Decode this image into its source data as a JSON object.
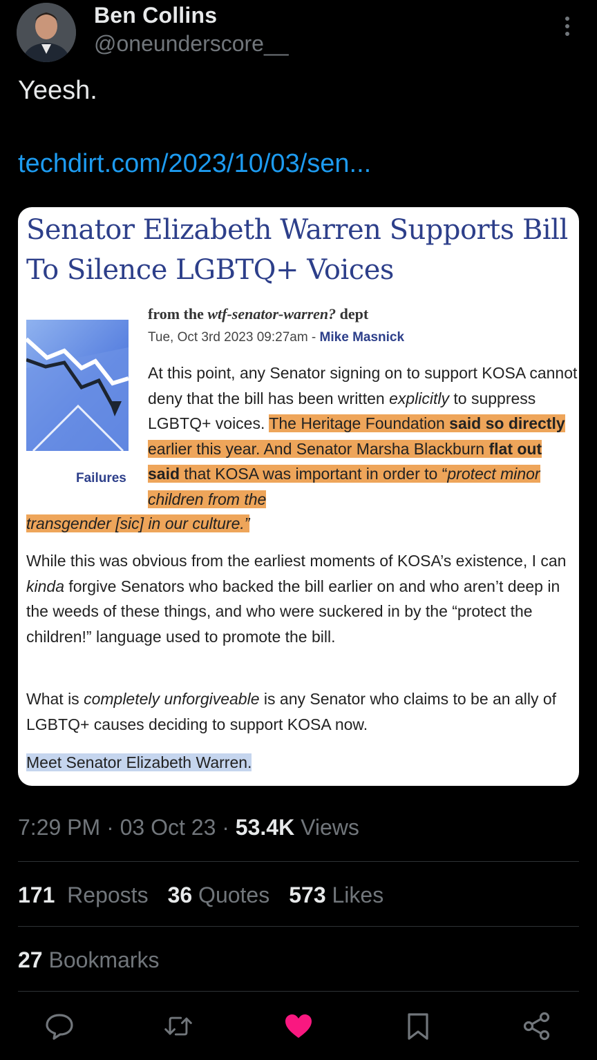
{
  "author": {
    "name": "Ben Collins",
    "handle": "@oneunderscore__"
  },
  "icons": {
    "more": "more-vertical-icon",
    "reply": "reply-icon",
    "repost": "repost-icon",
    "like": "heart-icon",
    "bookmark": "bookmark-icon",
    "share": "share-icon"
  },
  "colors": {
    "background": "#000000",
    "link": "#1d9bf0",
    "like_active": "#f91880",
    "highlight": "#eea55a",
    "headline": "#2d3f8a"
  },
  "tweet": {
    "text": "Yeesh.",
    "link": "techdirt.com/2023/10/03/sen..."
  },
  "card": {
    "headline": "Senator Elizabeth Warren Supports Bill To Silence LGBTQ+ Voices",
    "dept_prefix": "from the ",
    "dept_name": "wtf-senator-warren?",
    "dept_suffix": " dept",
    "date": "Tue, Oct 3rd 2023 09:27am - ",
    "byline_author": "Mike Masnick",
    "thumbnail_caption": "Failures",
    "p1_a": "At this point, any Senator signing on to support KOSA cannot deny that the bill has been written ",
    "p1_em": "explicitly",
    "p1_b": " to suppress LGBTQ+ voices. ",
    "p1_hl_1": "The Heritage Foundation ",
    "p1_hl_2": "said so directly",
    "p1_hl_3": " earlier this year. And Senator Marsha Blackburn ",
    "p1_hl_4": "flat out said",
    "p1_hl_5": " that KOSA was important in order to “",
    "p1_hl_6": "protect minor children from the",
    "p1_tail": "transgender [sic] in our culture.”",
    "p2_a": "While this was obvious from the earliest moments of KOSA’s existence, I can ",
    "p2_em": "kinda",
    "p2_b": " forgive Senators who backed the bill earlier on and who aren’t deep in the weeds of these things, and who were suckered in by the “protect the children!” language used to promote the bill.",
    "p3_a": "What is ",
    "p3_em": "completely unforgiveable",
    "p3_b": " is any Senator who claims to be an ally of LGBTQ+ causes deciding to support KOSA now.",
    "p4": "Meet Senator Elizabeth Warren."
  },
  "meta": {
    "time": "7:29 PM",
    "sep1": " · ",
    "date": "03 Oct 23",
    "sep2": " · ",
    "views_count": "53.4K",
    "views_label": " Views"
  },
  "stats": {
    "reposts_count": "171",
    "reposts_label": "Reposts",
    "quotes_count": "36",
    "quotes_label": "Quotes",
    "likes_count": "573",
    "likes_label": "Likes",
    "bookmarks_count": "27",
    "bookmarks_label": "Bookmarks"
  }
}
